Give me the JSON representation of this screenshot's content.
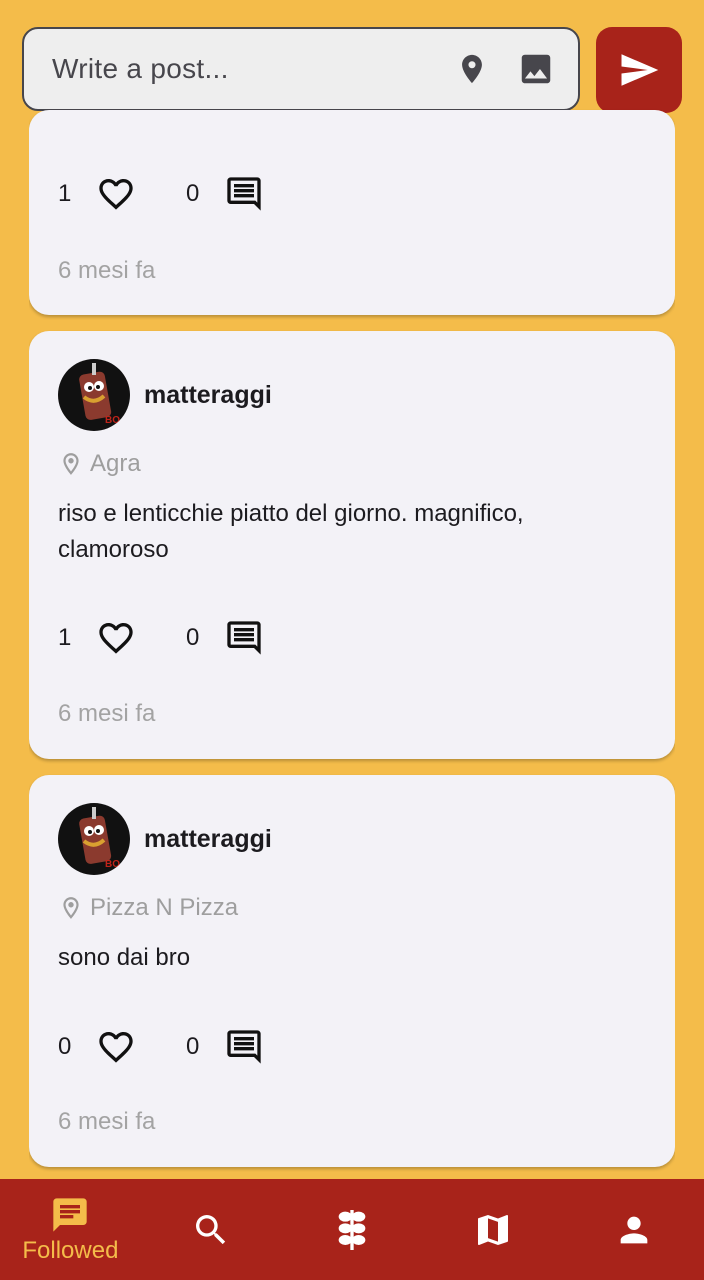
{
  "composer": {
    "placeholder": "Write a post...",
    "location_icon": "location-pin-icon",
    "image_icon": "image-icon",
    "send_icon": "send-icon"
  },
  "posts": [
    {
      "username": "",
      "location": "",
      "text": "",
      "likes": "1",
      "comments": "0",
      "time": "6 mesi fa"
    },
    {
      "username": "matteraggi",
      "location": "Agra",
      "text": "riso e lenticchie piatto del giorno. magnifico, clamoroso",
      "likes": "1",
      "comments": "0",
      "time": "6 mesi fa"
    },
    {
      "username": "matteraggi",
      "location": "Pizza N Pizza",
      "text": "sono dai bro",
      "likes": "0",
      "comments": "0",
      "time": "6 mesi fa"
    }
  ],
  "nav": {
    "items": [
      {
        "icon": "chat-icon",
        "label": "Followed",
        "active": true
      },
      {
        "icon": "search-icon",
        "label": ""
      },
      {
        "icon": "kebab-icon",
        "label": ""
      },
      {
        "icon": "map-icon",
        "label": ""
      },
      {
        "icon": "person-icon",
        "label": ""
      }
    ]
  },
  "colors": {
    "background": "#F4BC4A",
    "accent": "#A8231A",
    "card": "#F3F2F7"
  }
}
